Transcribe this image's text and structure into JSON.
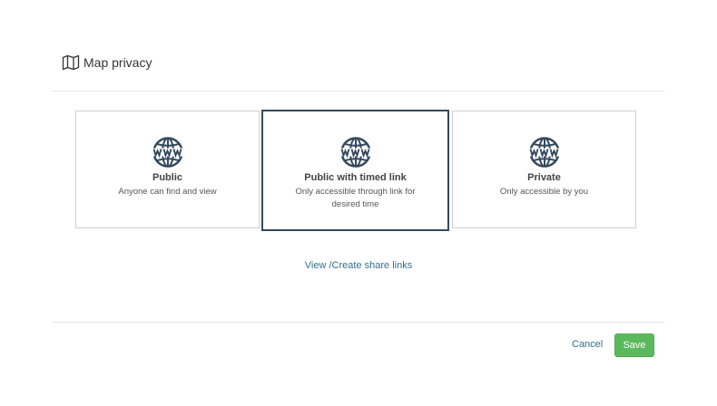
{
  "dialog": {
    "title": "Map privacy",
    "header_icon": "map-icon"
  },
  "options": [
    {
      "title": "Public",
      "description": "Anyone can find and view",
      "icon": "www-globe-icon",
      "selected": false
    },
    {
      "title": "Public with timed link",
      "description": "Only accessible through link for desired time",
      "icon": "www-globe-icon",
      "selected": true
    },
    {
      "title": "Private",
      "description": "Only accessible by you",
      "icon": "www-globe-icon",
      "selected": false
    }
  ],
  "share_link_label": "View /Create share links",
  "footer": {
    "cancel_label": "Cancel",
    "save_label": "Save"
  },
  "colors": {
    "accent_dark": "#34495e",
    "link": "#31708f",
    "save_green": "#5cb85c"
  }
}
